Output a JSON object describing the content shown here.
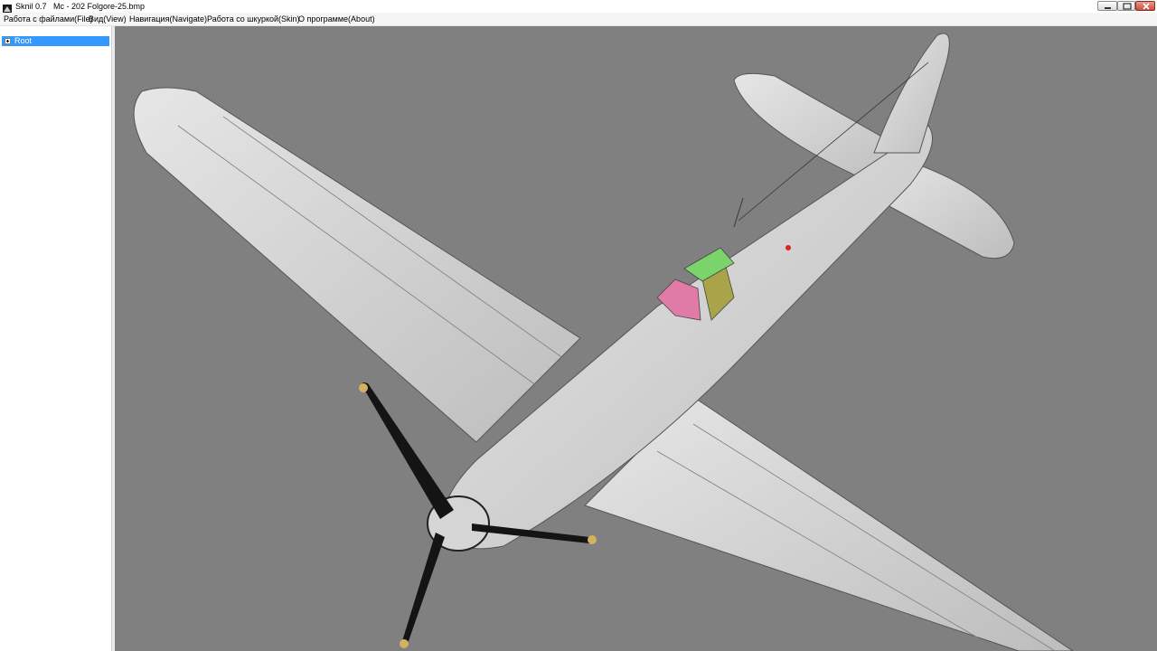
{
  "window": {
    "title": "Sknil 0.7   Mc - 202 Folgore-25.bmp"
  },
  "menu": {
    "items": [
      {
        "label": "Работа с файлами(File)"
      },
      {
        "label": "Вид(View)"
      },
      {
        "label": "Навигация(Navigate)"
      },
      {
        "label": "Работа со шкуркой(Skin)"
      },
      {
        "label": "О программе(About)"
      }
    ]
  },
  "tree": {
    "root_label": "Root"
  },
  "viewport": {
    "background": "#808080",
    "model_color": "#d8d8d8",
    "canopy_colors": [
      "#e07aa6",
      "#7bd36b",
      "#a9a44a"
    ],
    "propeller_color": "#141414",
    "prop_tip_color": "#d4b15e"
  }
}
